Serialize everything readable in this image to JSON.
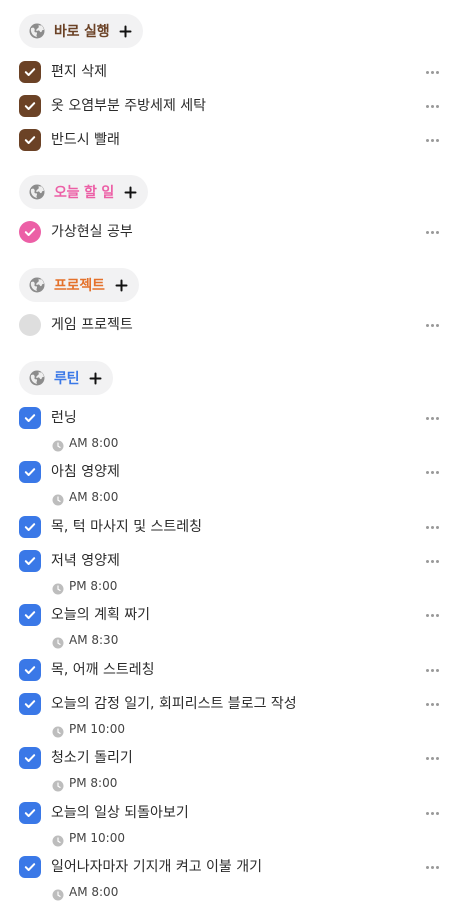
{
  "colors": {
    "brown": "#6b4226",
    "pink": "#ec5fa6",
    "orange": "#e4712b",
    "blue": "#3a78e7",
    "gray_cb": "#dedede"
  },
  "groups": [
    {
      "title": "바로 실행",
      "title_color": "#6b4226",
      "icon": "globe-icon",
      "add_icon": "plus-icon",
      "tasks": [
        {
          "label": "편지 삭제",
          "checked": true
        },
        {
          "label": "옷 오염부분 주방세제 세탁",
          "checked": true
        },
        {
          "label": "반드시 빨래",
          "checked": true
        }
      ]
    },
    {
      "title": "오늘 할 일",
      "title_color": "#ec5fa6",
      "icon": "globe-icon",
      "add_icon": "plus-icon",
      "tasks": [
        {
          "label": "가상현실 공부",
          "checked": true
        }
      ]
    },
    {
      "title": "프로젝트",
      "title_color": "#e4712b",
      "icon": "globe-icon",
      "add_icon": "plus-icon",
      "tasks": [
        {
          "label": "게임 프로젝트",
          "checked": false
        }
      ]
    },
    {
      "title": "루틴",
      "title_color": "#3a78e7",
      "icon": "globe-icon",
      "add_icon": "plus-icon",
      "tasks": [
        {
          "label": "런닝",
          "checked": true,
          "time": "AM 8:00"
        },
        {
          "label": "아침 영양제",
          "checked": true,
          "time": "AM 8:00"
        },
        {
          "label": "목, 턱 마사지 및 스트레칭",
          "checked": true
        },
        {
          "label": "저녁 영양제",
          "checked": true,
          "time": "PM 8:00"
        },
        {
          "label": "오늘의 계획 짜기",
          "checked": true,
          "time": "AM 8:30"
        },
        {
          "label": "목, 어깨 스트레칭",
          "checked": true
        },
        {
          "label": "오늘의 감정 일기, 회피리스트 블로그 작성",
          "checked": true,
          "time": "PM 10:00"
        },
        {
          "label": "청소기 돌리기",
          "checked": true,
          "time": "PM 8:00"
        },
        {
          "label": "오늘의 일상 되돌아보기",
          "checked": true,
          "time": "PM 10:00"
        },
        {
          "label": "일어나자마자 기지개 켜고 이불 개기",
          "checked": true,
          "time": "AM 8:00"
        }
      ]
    }
  ]
}
